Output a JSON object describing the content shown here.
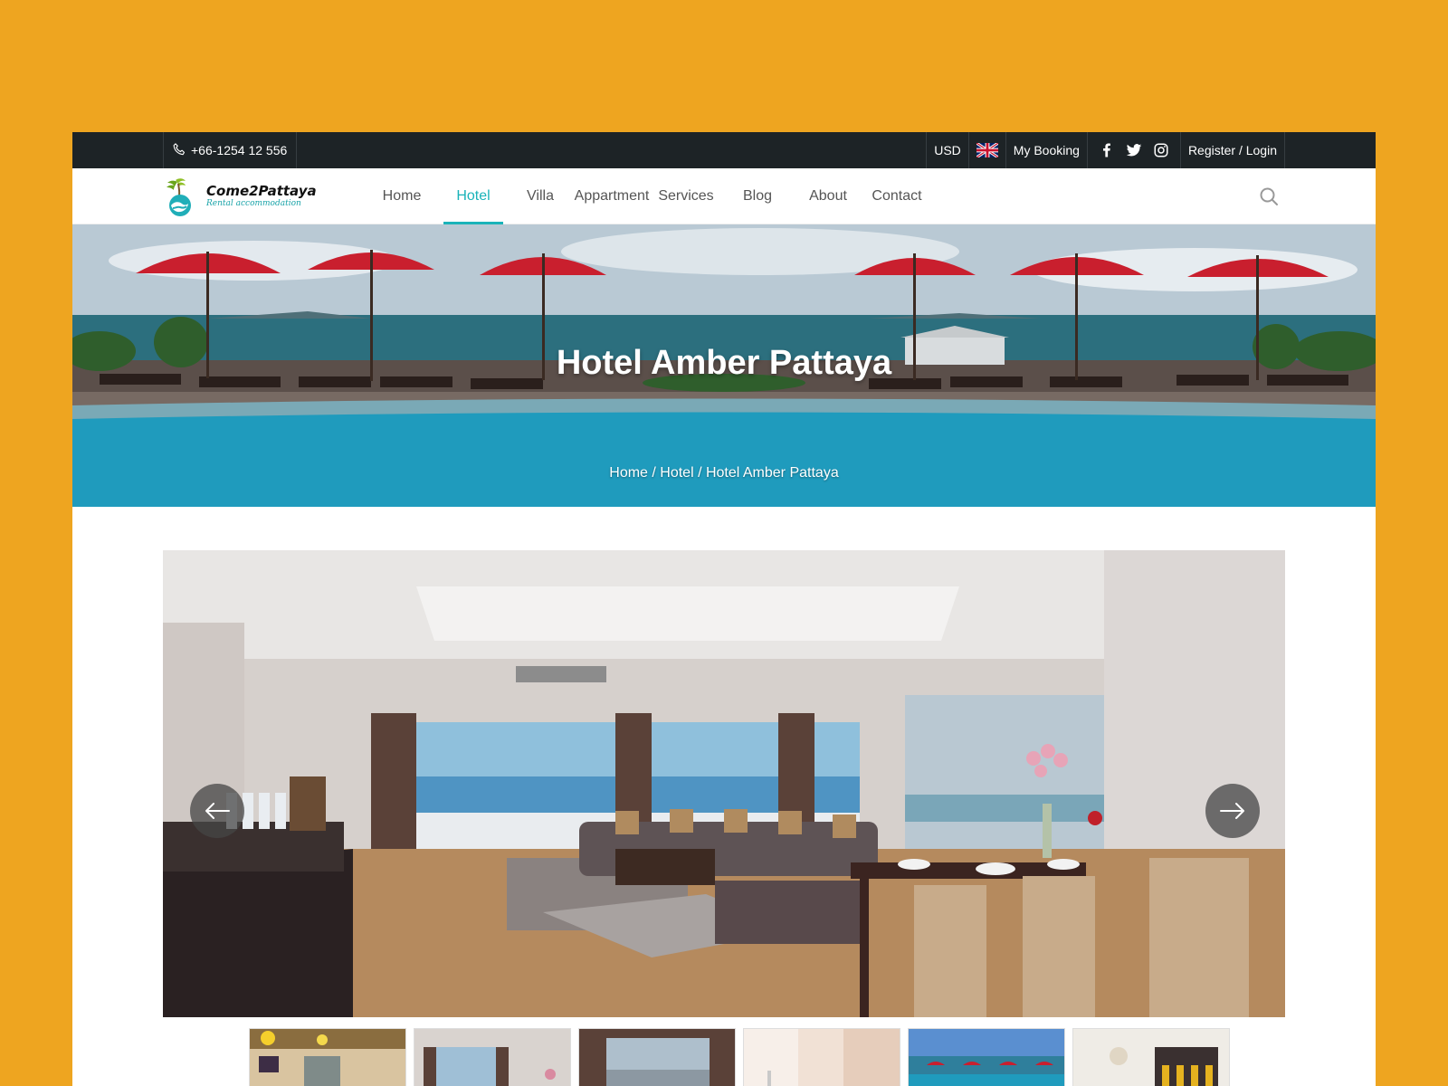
{
  "topbar": {
    "phone": "+66-1254 12 556",
    "currency": "USD",
    "language_icon": "uk-flag-icon",
    "my_booking": "My Booking",
    "social_icons": [
      "facebook-icon",
      "twitter-icon",
      "instagram-icon"
    ],
    "auth": "Register / Login"
  },
  "brand": {
    "name": "Come2Pattaya",
    "tagline": "Rental accommodation"
  },
  "nav": {
    "items": [
      {
        "label": "Home",
        "active": false
      },
      {
        "label": "Hotel",
        "active": true
      },
      {
        "label": "Villa",
        "active": false
      },
      {
        "label": "Appartment",
        "active": false
      },
      {
        "label": "Services",
        "active": false
      },
      {
        "label": "Blog",
        "active": false
      },
      {
        "label": "About",
        "active": false
      },
      {
        "label": "Contact",
        "active": false
      }
    ],
    "search_icon": "search-icon"
  },
  "hero": {
    "title": "Hotel Amber Pattaya",
    "breadcrumb": "Home / Hotel / Hotel Amber Pattaya"
  },
  "gallery": {
    "prev_icon": "arrow-left-icon",
    "next_icon": "arrow-right-icon",
    "thumbnail_count": 6
  },
  "colors": {
    "page_background": "#EEA520",
    "topbar": "#1d2326",
    "accent": "#1ab3b9"
  }
}
